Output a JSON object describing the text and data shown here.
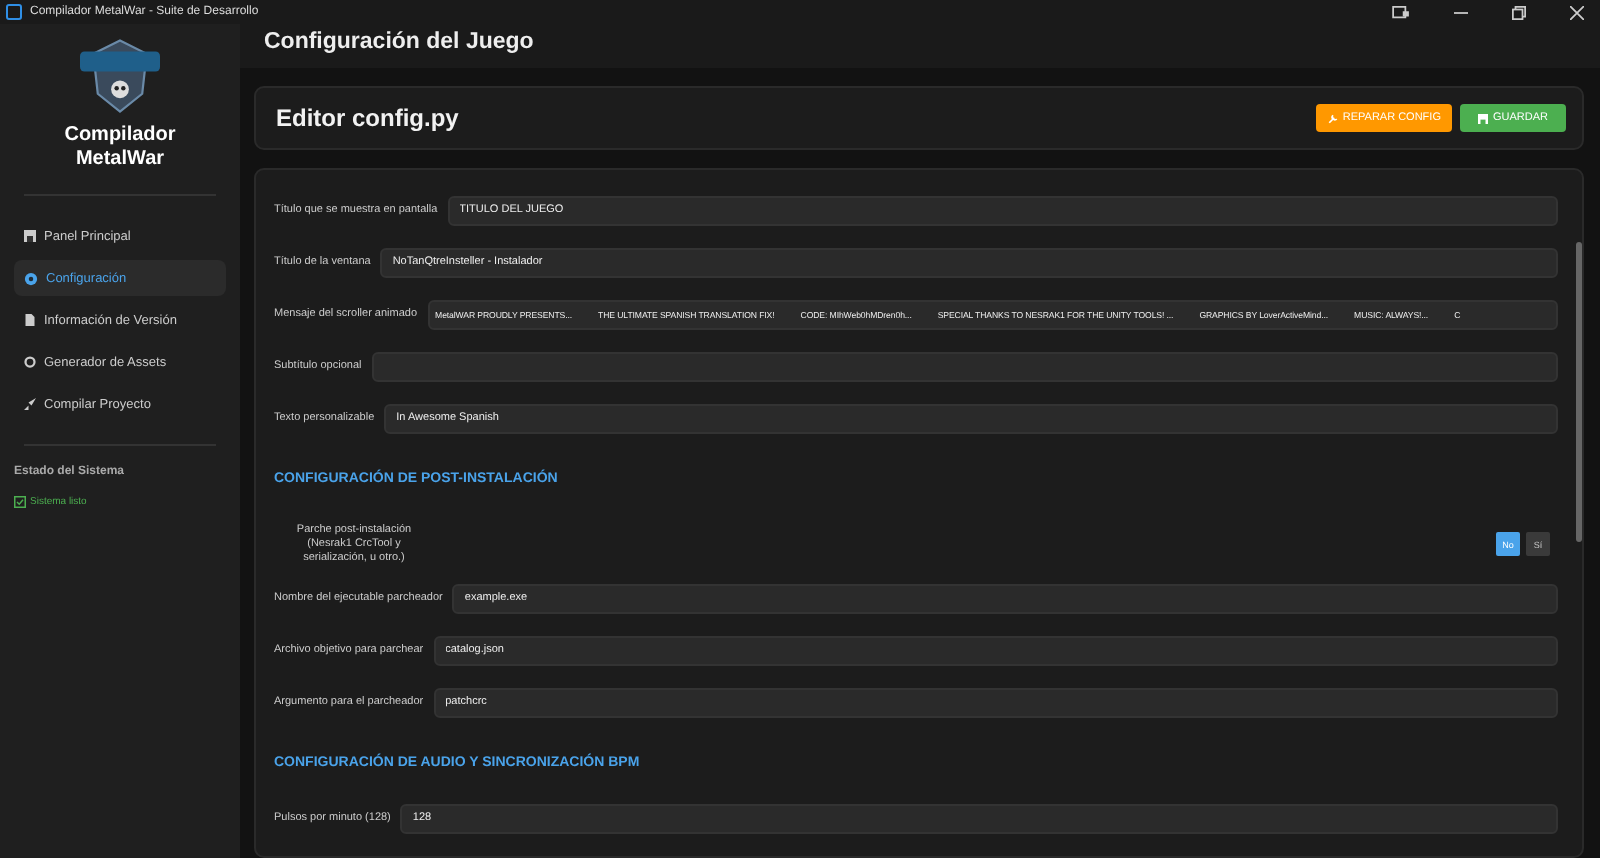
{
  "window": {
    "title": "Compilador MetalWar - Suite de Desarrollo"
  },
  "sidebar": {
    "title": "Compilador MetalWar",
    "items": [
      {
        "label": "Panel Principal",
        "selected": false,
        "kind": "panel"
      },
      {
        "label": "Configuración",
        "selected": true,
        "kind": "config"
      },
      {
        "label": "Información de Versión",
        "selected": false,
        "kind": "info"
      },
      {
        "label": "Generador de Assets",
        "selected": false,
        "kind": "assets"
      },
      {
        "label": "Compilar Proyecto",
        "selected": false,
        "kind": "compile"
      }
    ],
    "status_title": "Estado del Sistema",
    "status": "Sistema listo"
  },
  "header": {
    "title": "Configuración del Juego"
  },
  "editor": {
    "title": "Editor config.py",
    "buttons": [
      {
        "label": "REPARAR CONFIG",
        "kind": "repair"
      },
      {
        "label": "GUARDAR",
        "kind": "save"
      }
    ]
  },
  "form": [
    {
      "kind": "field",
      "label": "Título que se muestra en pantalla",
      "value": "TITULO DEL JUEGO"
    },
    {
      "kind": "field",
      "label": "Título de la ventana",
      "value": "NoTanQtreInsteller - Instalador"
    },
    {
      "kind": "scroller",
      "label": "Mensaje del scroller animado",
      "segments": [
        "MetalWAR PROUDLY PRESENTS...",
        "THE ULTIMATE SPANISH TRANSLATION FIX!",
        "CODE: MIhWeb0hMDren0h...",
        "SPECIAL THANKS TO NESRAK1 FOR THE UNITY TOOLS! ...",
        "GRAPHICS BY LoverActiveMind...",
        "MUSIC: ALWAYS!...",
        "C"
      ]
    },
    {
      "kind": "field",
      "label": "Subtítulo opcional"
    },
    {
      "kind": "field",
      "label": "Texto personalizable",
      "value": "In Awesome Spanish"
    },
    {
      "kind": "section",
      "label": "CONFIGURACIÓN DE POST-INSTALACIÓN"
    },
    {
      "kind": "toggle",
      "label": "Parche post-instalación (Nesrak1 CrcTool y serialización, u otro.)",
      "options": [
        {
          "label": "No",
          "selected": true
        },
        {
          "label": "Sí",
          "selected": false
        }
      ]
    },
    {
      "kind": "field",
      "label": "Nombre del ejecutable parcheador",
      "value": "example.exe"
    },
    {
      "kind": "field",
      "label": "Archivo objetivo para parchear",
      "value": "catalog.json"
    },
    {
      "kind": "field",
      "label": "Argumento para el parcheador",
      "value": "patchcrc"
    },
    {
      "kind": "section",
      "label": "CONFIGURACIÓN DE AUDIO Y SINCRONIZACIÓN BPM"
    },
    {
      "kind": "field",
      "label": "Pulsos por minuto (128)",
      "value": "128"
    }
  ]
}
